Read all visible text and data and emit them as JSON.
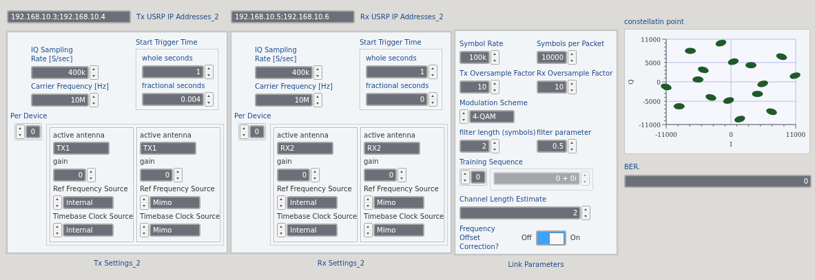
{
  "tx": {
    "ip_address": "192.168.10.3;192.168.10.4",
    "ip_label": "Tx USRP IP Addresses_2",
    "iq_rate_label": "IQ Sampling Rate [S/sec]",
    "iq_rate": "400k",
    "carrier_label": "Carrier Frequency [Hz]",
    "carrier": "10M",
    "trigger_title": "Start Trigger Time",
    "whole_label": "whole seconds",
    "whole": "1",
    "frac_label": "fractional seconds",
    "frac": "0.004",
    "per_device_label": "Per Device",
    "index": "0",
    "devices": [
      {
        "antenna_label": "active antenna",
        "antenna": "TX1",
        "gain_label": "gain",
        "gain": "0",
        "ref_label": "Ref Frequency Source",
        "ref": "Internal",
        "timebase_label": "Timebase Clock Source",
        "timebase": "Internal"
      },
      {
        "antenna_label": "active antenna",
        "antenna": "TX1",
        "gain_label": "gain",
        "gain": "0",
        "ref_label": "Ref Frequency Source",
        "ref": "Mimo",
        "timebase_label": "Timebase Clock Source",
        "timebase": "Mimo"
      }
    ],
    "caption": "Tx Settings_2"
  },
  "rx": {
    "ip_address": "192.168.10.5;192.168.10.6",
    "ip_label": "Rx USRP IP Addresses_2",
    "iq_rate_label": "IQ Sampling Rate [S/sec]",
    "iq_rate": "400k",
    "carrier_label": "Carrier Frequency [Hz]",
    "carrier": "10M",
    "trigger_title": "Start Trigger Time",
    "whole_label": "whole seconds",
    "whole": "1",
    "frac_label": "fractional seconds",
    "frac": "0",
    "per_device_label": "Per Device",
    "index": "0",
    "devices": [
      {
        "antenna_label": "active antenna",
        "antenna": "RX2",
        "gain_label": "gain",
        "gain": "0",
        "ref_label": "Ref Frequency Source",
        "ref": "Internal",
        "timebase_label": "Timebase Clock Source",
        "timebase": "Internal"
      },
      {
        "antenna_label": "active antenna",
        "antenna": "RX2",
        "gain_label": "gain",
        "gain": "0",
        "ref_label": "Ref Frequency Source",
        "ref": "Mimo",
        "timebase_label": "Timebase Clock Source",
        "timebase": "Mimo"
      }
    ],
    "caption": "Rx Settings_2"
  },
  "link": {
    "items": [
      {
        "kind": "numeric",
        "label": "Symbol Rate",
        "value": "100k"
      },
      {
        "kind": "numeric",
        "label": "Symbols per Packet",
        "value": "10000"
      },
      {
        "kind": "numeric",
        "label": "Tx Oversample Factor",
        "value": "10"
      },
      {
        "kind": "numeric",
        "label": "Rx Oversample Factor",
        "value": "10"
      },
      {
        "kind": "ring",
        "label": "Modulation Scheme",
        "value": "4-QAM"
      },
      {
        "kind": "numeric",
        "label": "filter length (symbols)",
        "value": "2"
      },
      {
        "kind": "numeric",
        "label": "filter parameter",
        "value": "0.5"
      },
      {
        "kind": "array",
        "label": "Training Sequence",
        "index": "0",
        "value": "0 + 0i",
        "disabled": true
      },
      {
        "kind": "wide",
        "label": "Channel Length Estimate",
        "value": "2"
      },
      {
        "kind": "switch",
        "label": "Frequency Offset Correction?",
        "off_text": "Off",
        "on_text": "On",
        "on": true
      }
    ],
    "caption": "Link Parameters"
  },
  "chart_data": {
    "type": "scatter",
    "title": "constellatin point",
    "xlabel": "I",
    "ylabel": "Q",
    "xlim": [
      -11000,
      11000
    ],
    "ylim": [
      -11000,
      11000
    ],
    "xticks": [
      -11000,
      0,
      11000
    ],
    "yticks": [
      -11000,
      -5000,
      0,
      5000,
      11000
    ],
    "grid": true,
    "x": [
      -1700,
      -6900,
      8600,
      400,
      3400,
      -4700,
      10900,
      -5600,
      -11000,
      5400,
      4500,
      -3400,
      -400,
      -8800,
      6900,
      1500
    ],
    "series": [
      {
        "color": "#1f5a2a",
        "values": [
          10000,
          8000,
          6500,
          5200,
          4300,
          3100,
          1600,
          600,
          -1300,
          -500,
          -3100,
          -4000,
          -4800,
          -6300,
          -7700,
          -9600
        ]
      }
    ]
  },
  "ber": {
    "label": "BER.",
    "value": "0"
  }
}
